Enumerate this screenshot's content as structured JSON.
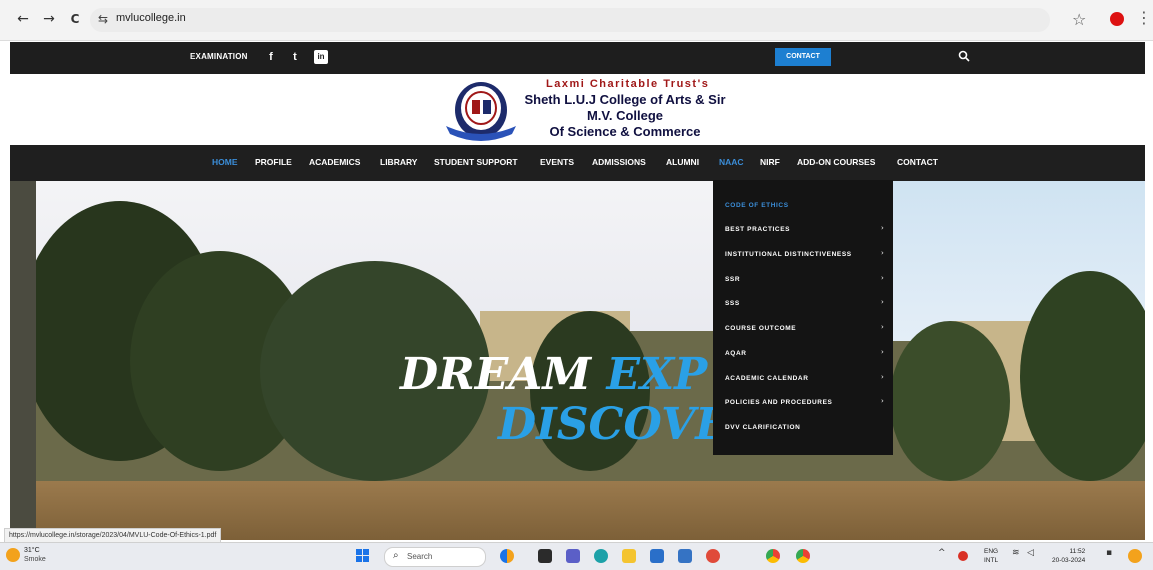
{
  "browser": {
    "url": "mvlucollege.in",
    "back_icon": "←",
    "forward_icon": "→",
    "reload_icon": "C",
    "star_icon": "☆",
    "menu_icon": "⋮"
  },
  "topbar": {
    "examination": "EXAMINATION",
    "social": [
      "f",
      "t",
      "in"
    ],
    "contact": "CONTACT"
  },
  "header": {
    "trust": "Laxmi Charitable Trust's",
    "college_line1": "Sheth L.U.J College of Arts & Sir",
    "college_line2": "M.V. College",
    "college_line3": "Of Science & Commerce"
  },
  "nav": {
    "items": [
      {
        "label": "HOME",
        "active": true
      },
      {
        "label": "PROFILE"
      },
      {
        "label": "ACADEMICS"
      },
      {
        "label": "LIBRARY"
      },
      {
        "label": "STUDENT SUPPORT"
      },
      {
        "label": "EVENTS"
      },
      {
        "label": "ADMISSIONS"
      },
      {
        "label": "ALUMNI"
      },
      {
        "label": "NAAC",
        "active": true
      },
      {
        "label": "NIRF"
      },
      {
        "label": "ADD-ON COURSES"
      },
      {
        "label": "CONTACT"
      }
    ]
  },
  "dropdown": {
    "items": [
      {
        "label": "CODE OF ETHICS",
        "active": true,
        "arrow": false
      },
      {
        "label": "BEST PRACTICES",
        "arrow": true
      },
      {
        "label": "INSTITUTIONAL DISTINCTIVENESS",
        "arrow": true
      },
      {
        "label": "SSR",
        "arrow": true
      },
      {
        "label": "SSS",
        "arrow": true
      },
      {
        "label": "COURSE OUTCOME",
        "arrow": true
      },
      {
        "label": "AQAR",
        "arrow": true
      },
      {
        "label": "ACADEMIC CALENDAR",
        "arrow": true
      },
      {
        "label": "POLICIES AND PROCEDURES",
        "arrow": true
      },
      {
        "label": "DVV CLARIFICATION",
        "arrow": false
      }
    ],
    "arrow_glyph": "›"
  },
  "hero": {
    "word1": "DREAM",
    "word2": "EXP",
    "word3": "DISCOVEI"
  },
  "status_url": "https://mvlucollege.in/storage/2023/04/MVLU-Code-Of-Ethics-1.pdf",
  "taskbar": {
    "temp": "31°C",
    "weather": "Smoke",
    "search_placeholder": "Search",
    "lang_line1": "ENG",
    "lang_line2": "INTL",
    "time": "11:52",
    "date": "20-03-2024"
  },
  "colors": {
    "accent_blue": "#2aa0e6",
    "nav_bg": "#1f1f1f",
    "trust_red": "#a01818"
  }
}
